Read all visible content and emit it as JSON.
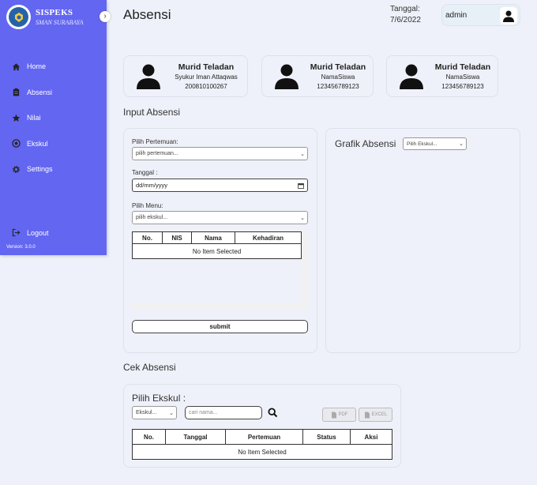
{
  "sidebar": {
    "brand_title": "SISPEKS",
    "brand_sub": "SMAN SURABAYA",
    "items": [
      {
        "label": "Home",
        "icon": "home-icon"
      },
      {
        "label": "Absensi",
        "icon": "clipboard-icon"
      },
      {
        "label": "Nilai",
        "icon": "star-icon"
      },
      {
        "label": "Ekskul",
        "icon": "ball-icon"
      },
      {
        "label": "Settings",
        "icon": "gear-icon"
      }
    ],
    "logout": "Logout",
    "version": "Version: 3.0.0"
  },
  "header": {
    "title": "Absensi",
    "date_label": "Tanggal:",
    "date_value": "7/6/2022",
    "user": "admin"
  },
  "students": [
    {
      "title": "Murid Teladan",
      "name": "Syukur Iman Attaqwas",
      "id": "200810100267"
    },
    {
      "title": "Murid Teladan",
      "name": "NamaSiswa",
      "id": "123456789123"
    },
    {
      "title": "Murid Teladan",
      "name": "NamaSiswa",
      "id": "123456789123"
    }
  ],
  "input": {
    "section": "Input Absensi",
    "pertemuan_label": "Pilih Pertemuan:",
    "pertemuan_value": "pilih pertemuan...",
    "tanggal_label": "Tanggal :",
    "tanggal_value": "dd/mm/yyyy",
    "menu_label": "Pilih Menu:",
    "menu_value": "pilih ekskul...",
    "columns": [
      "No.",
      "NIS",
      "Nama",
      "Kehadiran"
    ],
    "empty": "No Item Selected",
    "submit": "submit"
  },
  "grafik": {
    "title": "Grafik Absensi",
    "select": "Pilih Ekskul..."
  },
  "cek": {
    "section": "Cek Absensi",
    "label": "Pilih Ekskul :",
    "select": "Ekskul...",
    "search_placeholder": "cari nama...",
    "pdf": "PDF",
    "excel": "EXCEL",
    "columns": [
      "No.",
      "Tanggal",
      "Pertemuan",
      "Status",
      "Aksi"
    ],
    "empty": "No Item Selected"
  },
  "colors": {
    "sidebar": "#6366f1",
    "background": "#eef1f9"
  }
}
